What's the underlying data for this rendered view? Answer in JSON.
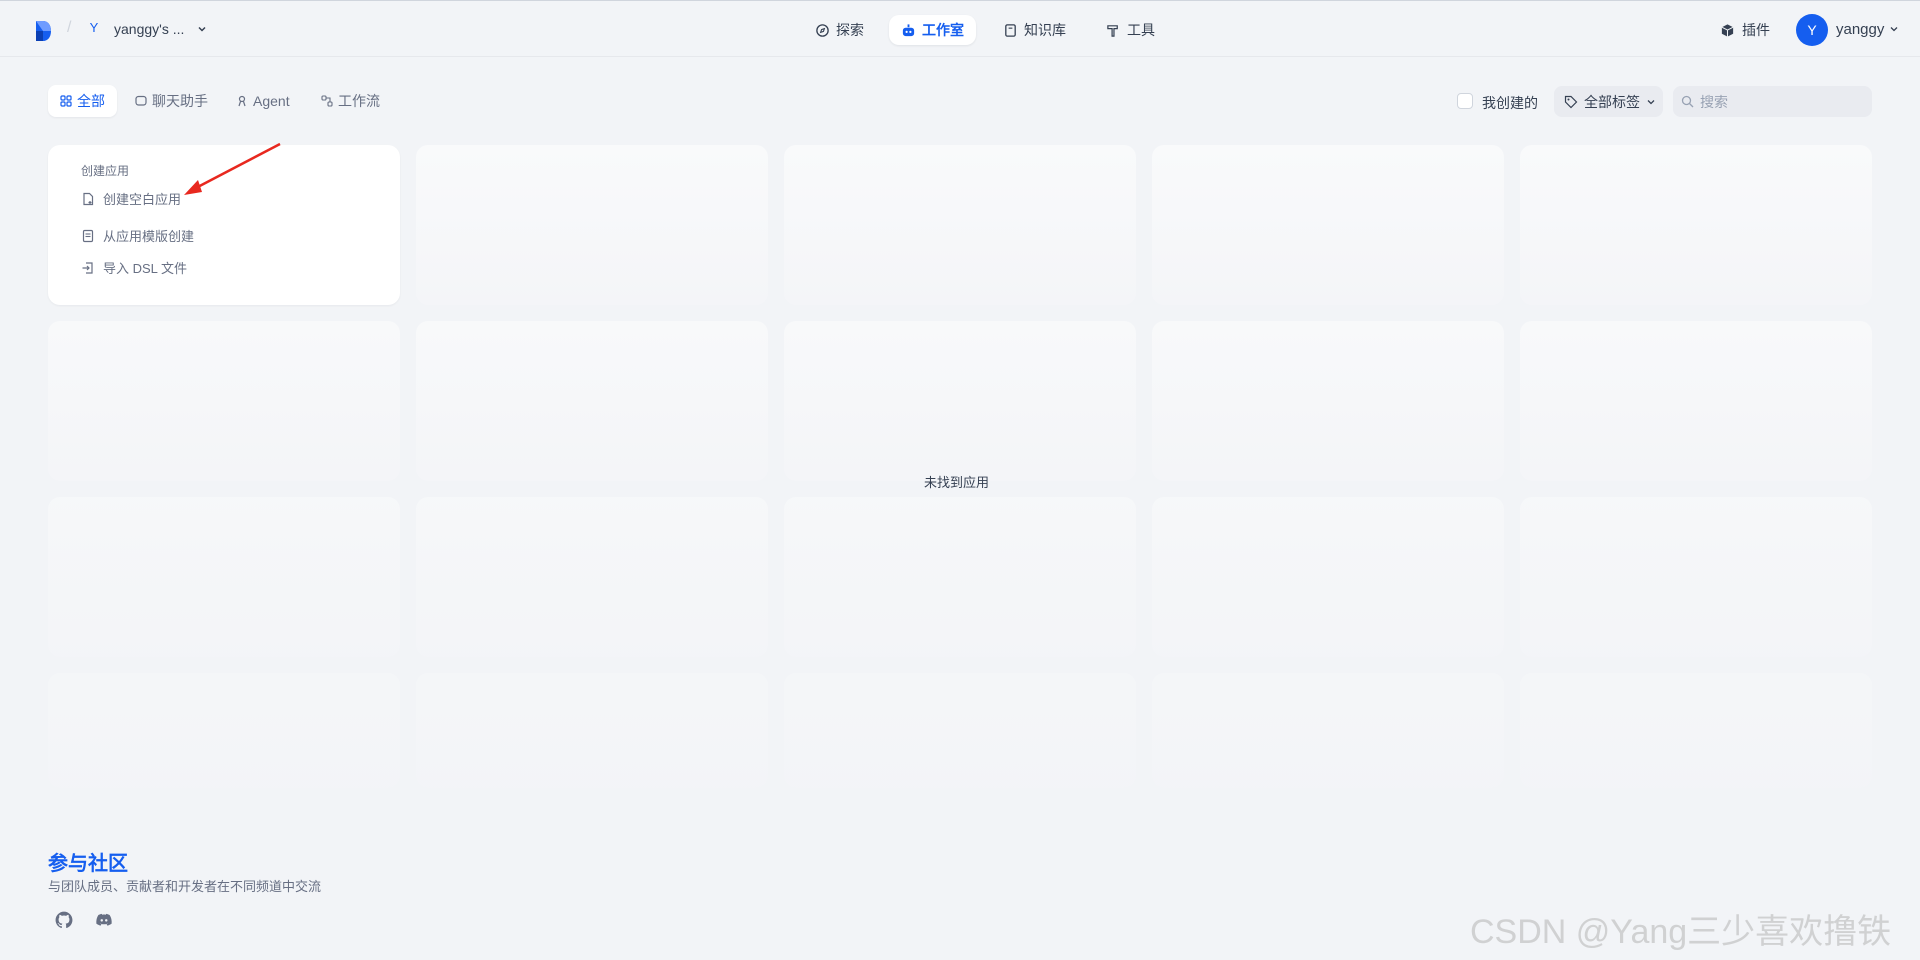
{
  "header": {
    "workspace_initial": "Y",
    "workspace_name": "yanggy's ...",
    "nav": [
      {
        "label": "探索",
        "icon": "compass-icon"
      },
      {
        "label": "工作室",
        "icon": "robot-icon",
        "active": true
      },
      {
        "label": "知识库",
        "icon": "book-icon"
      },
      {
        "label": "工具",
        "icon": "hammer-icon"
      }
    ],
    "plugins_label": "插件",
    "user_initial": "Y",
    "user_name": "yanggy"
  },
  "filters": {
    "tabs": [
      {
        "label": "全部",
        "icon": "grid-icon",
        "active": true
      },
      {
        "label": "聊天助手",
        "icon": "chat-icon"
      },
      {
        "label": "Agent",
        "icon": "agent-icon"
      },
      {
        "label": "工作流",
        "icon": "workflow-icon"
      }
    ],
    "mine_label": "我创建的",
    "tags_label": "全部标签",
    "search_placeholder": "搜索"
  },
  "create_card": {
    "title": "创建应用",
    "items": [
      {
        "label": "创建空白应用",
        "icon": "blank-file-icon"
      },
      {
        "label": "从应用模版创建",
        "icon": "template-icon"
      },
      {
        "label": "导入 DSL 文件",
        "icon": "import-icon"
      }
    ]
  },
  "empty_message": "未找到应用",
  "footer": {
    "title": "参与社区",
    "description": "与团队成员、贡献者和开发者在不同频道中交流",
    "icons": [
      "github-icon",
      "discord-icon"
    ]
  },
  "watermark": "CSDN @Yang三少喜欢撸铁",
  "colors": {
    "accent": "#155eef",
    "background": "#f2f4f7",
    "annotation_arrow": "#e8281f"
  }
}
